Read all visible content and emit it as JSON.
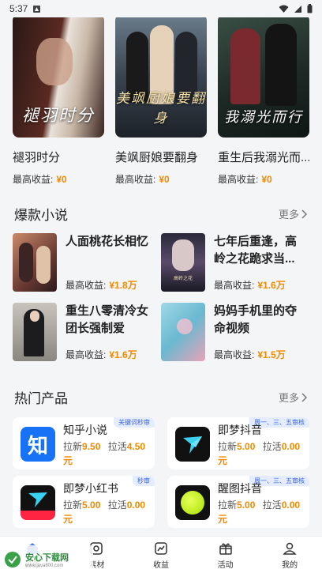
{
  "status_bar": {
    "time": "5:37"
  },
  "dramas": [
    {
      "name": "褪羽时分",
      "poster_text": "褪羽时分",
      "earn_label": "最高收益:",
      "earn_value": "¥0"
    },
    {
      "name": "美飒厨娘要翻身",
      "poster_text": "美飒厨娘要翻身",
      "earn_label": "最高收益:",
      "earn_value": "¥0"
    },
    {
      "name": "重生后我溺光而...",
      "poster_text": "我溺光而行",
      "earn_label": "最高收益:",
      "earn_value": "¥0"
    }
  ],
  "novels_section": {
    "title": "爆款小说",
    "more": "更多"
  },
  "novels": [
    {
      "title": "人面桃花长相忆",
      "earn_label": "最高收益:",
      "earn_value": "¥1.8万"
    },
    {
      "title": "七年后重逢，高岭之花跪求当...",
      "earn_label": "最高收益:",
      "earn_value": "¥1.6万"
    },
    {
      "title": "重生八零清冷女团长强制爱",
      "earn_label": "最高收益:",
      "earn_value": "¥1.6万"
    },
    {
      "title": "妈妈手机里的夺命视频",
      "earn_label": "最高收益:",
      "earn_value": "¥1.5万"
    }
  ],
  "products_section": {
    "title": "热门产品",
    "more": "更多"
  },
  "products": [
    {
      "name": "知乎小说",
      "badge": "关键词秒审",
      "new_label": "拉新",
      "new_value": "9.50",
      "active_label": "拉活",
      "active_value": "4.50",
      "unit": "元"
    },
    {
      "name": "即梦抖音",
      "badge": "周一、三、五审核",
      "new_label": "拉新",
      "new_value": "5.00",
      "active_label": "拉活",
      "active_value": "0.00",
      "unit": "元"
    },
    {
      "name": "即梦小红书",
      "badge": "秒审",
      "new_label": "拉新",
      "new_value": "5.00",
      "active_label": "拉活",
      "active_value": "0.00",
      "unit": "元"
    },
    {
      "name": "醒图抖音",
      "badge": "周一、三、五审核",
      "new_label": "拉新",
      "new_value": "5.00",
      "active_label": "拉活",
      "active_value": "0.00",
      "unit": "元"
    }
  ],
  "bottom_nav": [
    "首页",
    "素材",
    "收益",
    "活动",
    "我的"
  ],
  "watermark": {
    "brand": "安心下载网",
    "url": "www.java800.com"
  },
  "colors": {
    "accent": "#f08a00",
    "badge_blue": "#3a64e6"
  }
}
